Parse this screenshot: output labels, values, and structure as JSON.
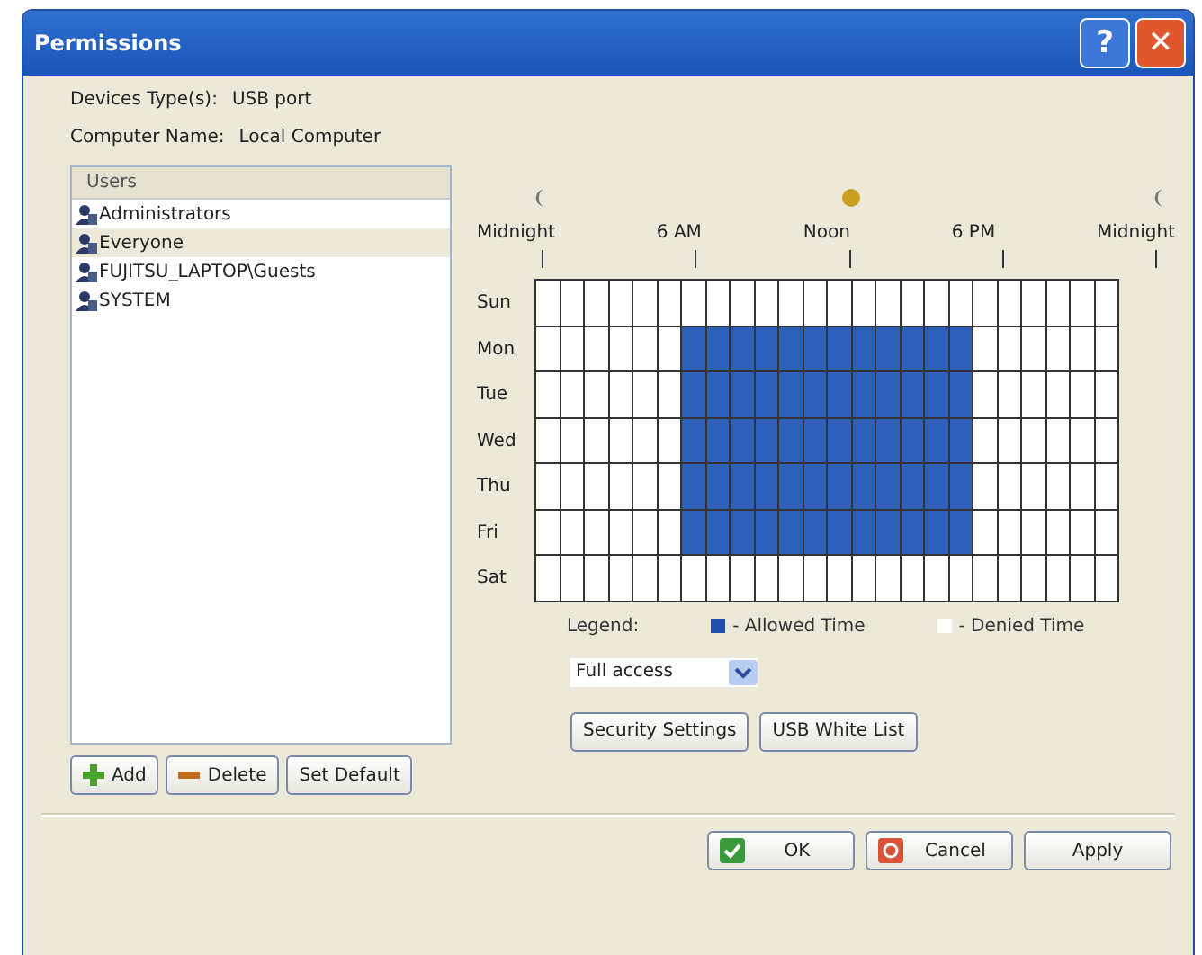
{
  "window": {
    "title": "Permissions",
    "help": "?",
    "close": "✕"
  },
  "info": [
    {
      "label": "Devices Type(s):",
      "value": "USB port"
    },
    {
      "label": "Computer Name:",
      "value": "Local Computer"
    }
  ],
  "users": {
    "header": "Users",
    "items": [
      {
        "name": "Administrators",
        "selected": false
      },
      {
        "name": "Everyone",
        "selected": true
      },
      {
        "name": "FUJITSU_LAPTOP\\Guests",
        "selected": false
      },
      {
        "name": "SYSTEM",
        "selected": false
      }
    ]
  },
  "user_buttons": [
    {
      "label": "Add",
      "kind": "add"
    },
    {
      "label": "Delete",
      "kind": "delete"
    },
    {
      "label": "Set Default",
      "kind": "plain"
    }
  ],
  "schedule": {
    "time_icons": [
      {
        "kind": "moon"
      },
      {
        "kind": "sun"
      },
      {
        "kind": "moon"
      }
    ],
    "time_labels": [
      "Midnight",
      "6 AM",
      "Noon",
      "6 PM",
      "Midnight"
    ],
    "days": [
      {
        "label": "Sun",
        "cells": [
          false,
          false,
          false,
          false,
          false,
          false,
          false,
          false,
          false,
          false,
          false,
          false,
          false,
          false,
          false,
          false,
          false,
          false,
          false,
          false,
          false,
          false,
          false,
          false
        ]
      },
      {
        "label": "Mon",
        "cells": [
          false,
          false,
          false,
          false,
          false,
          false,
          true,
          true,
          true,
          true,
          true,
          true,
          true,
          true,
          true,
          true,
          true,
          true,
          false,
          false,
          false,
          false,
          false,
          false
        ]
      },
      {
        "label": "Tue",
        "cells": [
          false,
          false,
          false,
          false,
          false,
          false,
          true,
          true,
          true,
          true,
          true,
          true,
          true,
          true,
          true,
          true,
          true,
          true,
          false,
          false,
          false,
          false,
          false,
          false
        ]
      },
      {
        "label": "Wed",
        "cells": [
          false,
          false,
          false,
          false,
          false,
          false,
          true,
          true,
          true,
          true,
          true,
          true,
          true,
          true,
          true,
          true,
          true,
          true,
          false,
          false,
          false,
          false,
          false,
          false
        ]
      },
      {
        "label": "Thu",
        "cells": [
          false,
          false,
          false,
          false,
          false,
          false,
          true,
          true,
          true,
          true,
          true,
          true,
          true,
          true,
          true,
          true,
          true,
          true,
          false,
          false,
          false,
          false,
          false,
          false
        ]
      },
      {
        "label": "Fri",
        "cells": [
          false,
          false,
          false,
          false,
          false,
          false,
          true,
          true,
          true,
          true,
          true,
          true,
          true,
          true,
          true,
          true,
          true,
          true,
          false,
          false,
          false,
          false,
          false,
          false
        ]
      },
      {
        "label": "Sat",
        "cells": [
          false,
          false,
          false,
          false,
          false,
          false,
          false,
          false,
          false,
          false,
          false,
          false,
          false,
          false,
          false,
          false,
          false,
          false,
          false,
          false,
          false,
          false,
          false,
          false
        ]
      }
    ],
    "legend": {
      "label": "Legend:",
      "allowed": "- Allowed Time",
      "denied": "- Denied Time"
    },
    "access": {
      "value": "Full access"
    }
  },
  "schedule_buttons": [
    "Security Settings",
    "USB White List"
  ],
  "dialog_buttons": [
    {
      "label": "OK",
      "kind": "ok"
    },
    {
      "label": "Cancel",
      "kind": "cancel"
    },
    {
      "label": "Apply",
      "kind": "plain"
    }
  ]
}
